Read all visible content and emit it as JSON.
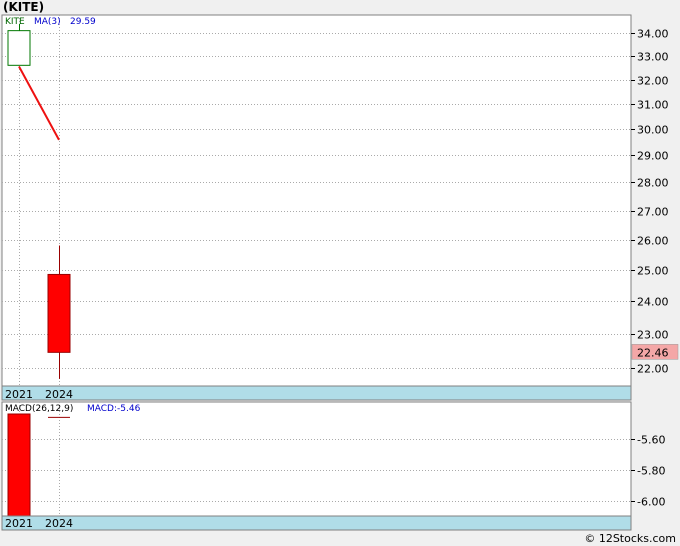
{
  "title": "(KITE)",
  "credit": "© 12Stocks.com",
  "colors": {
    "background": "#f0f0f0",
    "panel": "#ffffff",
    "grid": "#aaaaaa",
    "axis_band": "#b0dde8",
    "up": "#ffffff",
    "up_border": "#007700",
    "down": "#ff0000",
    "down_border": "#990000",
    "ma": "#ee1111",
    "legend_ticker": "#006600",
    "legend_indicator": "#0000cc",
    "last_price_bg": "#f4a7a7"
  },
  "chart_data": [
    {
      "type": "candlestick",
      "ticker": "KITE",
      "legend": {
        "ticker": "KITE",
        "ma_label": "MA(3)",
        "ma_value": "29.59"
      },
      "categories": [
        "2021",
        "2024"
      ],
      "candles": [
        {
          "x": "2021",
          "open": 32.6,
          "high": 34.4,
          "low": 32.6,
          "close": 34.1,
          "direction": "up"
        },
        {
          "x": "2024",
          "open": 24.85,
          "high": 25.8,
          "low": 21.7,
          "close": 22.46,
          "direction": "down"
        }
      ],
      "ma_line": [
        {
          "x": "2021",
          "y": 32.55
        },
        {
          "x": "2024",
          "y": 29.59
        }
      ],
      "ylim": [
        21.5,
        34.8
      ],
      "yticks": [
        {
          "value": 22.0,
          "label": "22.00"
        },
        {
          "value": 23.0,
          "label": "23.00"
        },
        {
          "value": 24.0,
          "label": "24.00"
        },
        {
          "value": 25.0,
          "label": "25.00"
        },
        {
          "value": 26.0,
          "label": "26.00"
        },
        {
          "value": 27.0,
          "label": "27.00"
        },
        {
          "value": 28.0,
          "label": "28.00"
        },
        {
          "value": 29.0,
          "label": "29.00"
        },
        {
          "value": 30.0,
          "label": "30.00"
        },
        {
          "value": 31.0,
          "label": "31.00"
        },
        {
          "value": 32.0,
          "label": "32.00"
        },
        {
          "value": 33.0,
          "label": "33.00"
        },
        {
          "value": 34.0,
          "label": "34.00"
        }
      ],
      "yscale": "log",
      "last_price": "22.46",
      "grid": true
    },
    {
      "type": "bar",
      "indicator": "MACD",
      "legend": {
        "label": "MACD(26,12,9)",
        "value_label": "MACD:-5.46"
      },
      "categories": [
        "2021",
        "2024"
      ],
      "values": [
        -5.36,
        -5.46
      ],
      "ylim": [
        -6.1,
        -5.36
      ],
      "yticks": [
        {
          "value": -5.6,
          "label": "-5.60"
        },
        {
          "value": -5.8,
          "label": "-5.80"
        },
        {
          "value": -6.0,
          "label": "-6.00"
        }
      ],
      "grid": true
    }
  ]
}
